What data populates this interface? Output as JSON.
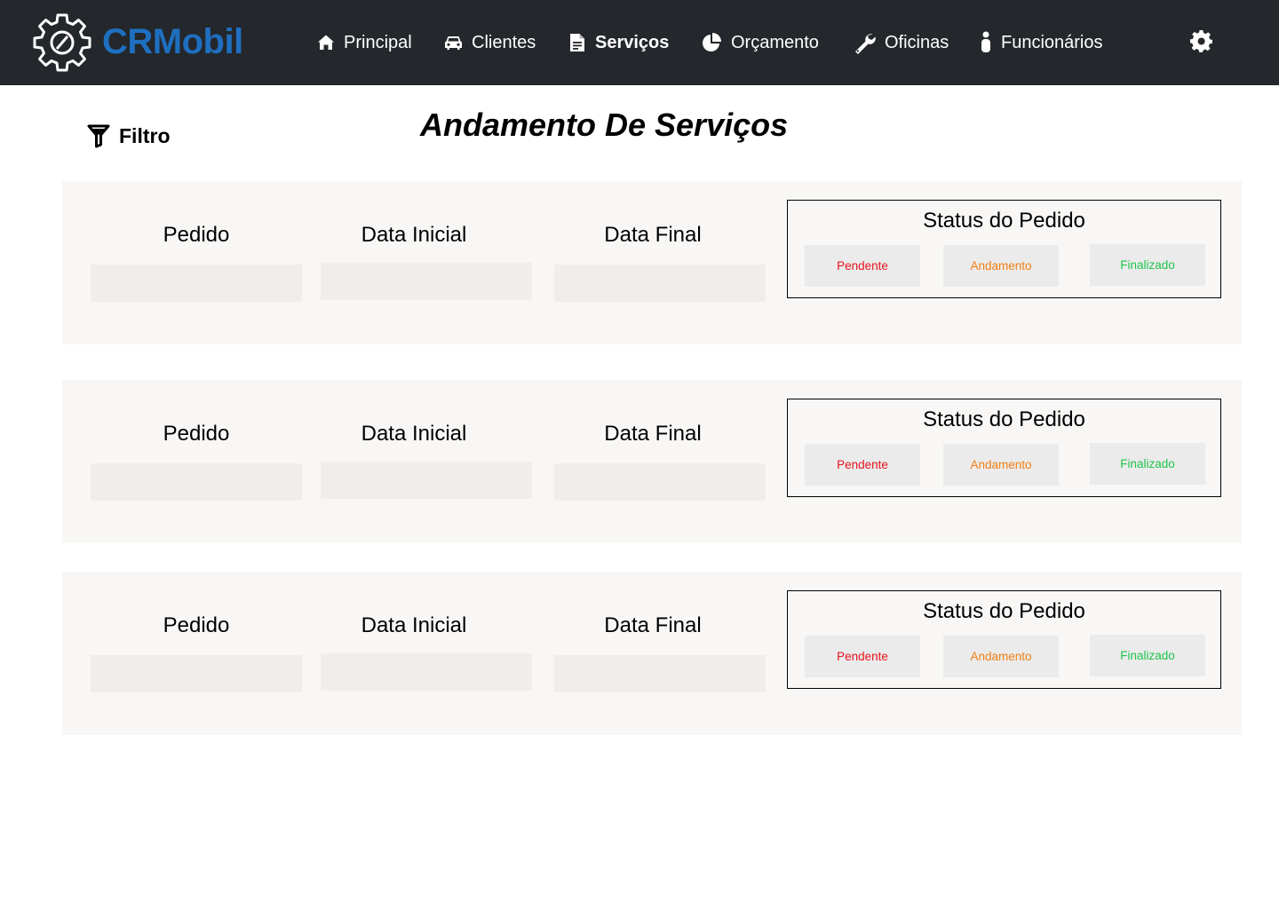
{
  "header": {
    "brand": "CRMobil",
    "nav": [
      {
        "label": "Principal",
        "icon": "home-icon"
      },
      {
        "label": "Clientes",
        "icon": "car-icon"
      },
      {
        "label": "Serviços",
        "icon": "document-icon",
        "active": true
      },
      {
        "label": "Orçamento",
        "icon": "pie-chart-icon"
      },
      {
        "label": "Oficinas",
        "icon": "wrench-icon"
      },
      {
        "label": "Funcionários",
        "icon": "person-icon"
      }
    ],
    "settings_icon": "gear-icon"
  },
  "filter": {
    "label": "Filtro",
    "icon": "filter-icon"
  },
  "page_title": "Andamento De Serviços",
  "cards": [
    {
      "pedido_label": "Pedido",
      "data_inicial_label": "Data Inicial",
      "data_final_label": "Data Final",
      "status": {
        "title": "Status do Pedido",
        "pendente": "Pendente",
        "andamento": "Andamento",
        "finalizado": "Finalizado"
      }
    },
    {
      "pedido_label": "Pedido",
      "data_inicial_label": "Data Inicial",
      "data_final_label": "Data Final",
      "status": {
        "title": "Status do Pedido",
        "pendente": "Pendente",
        "andamento": "Andamento",
        "finalizado": "Finalizado"
      }
    },
    {
      "pedido_label": "Pedido",
      "data_inicial_label": "Data Inicial",
      "data_final_label": "Data Final",
      "status": {
        "title": "Status do Pedido",
        "pendente": "Pendente",
        "andamento": "Andamento",
        "finalizado": "Finalizado"
      }
    }
  ],
  "colors": {
    "topbar": "#24272b",
    "brand": "#1e6fc0",
    "pendente": "#e8141f",
    "andamento": "#f07f13",
    "finalizado": "#1fc44b",
    "card_bg": "#f8f7f5"
  }
}
